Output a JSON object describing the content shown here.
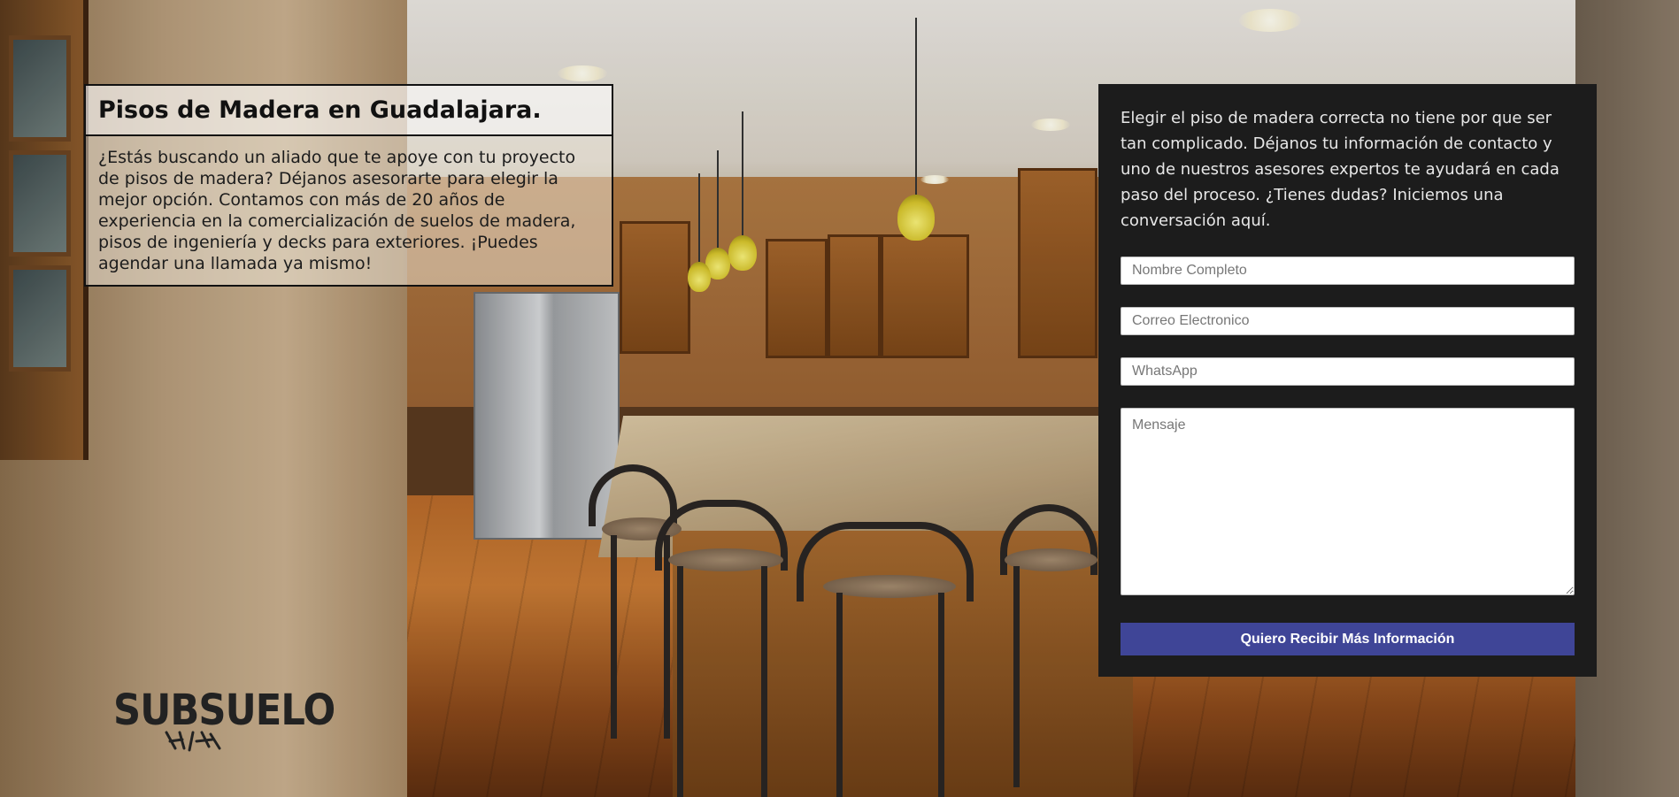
{
  "hero": {
    "title": "Pisos de Madera en Guadalajara.",
    "text": "¿Estás buscando un aliado que te apoye con tu proyecto de pisos de madera? Déjanos asesorarte para elegir la mejor opción. Contamos con más de 20 años de experiencia en la comercialización de suelos de madera, pisos de ingeniería y decks para exteriores. ¡Puedes agendar una llamada ya mismo!"
  },
  "logo": {
    "text": "SUBSUELO"
  },
  "form": {
    "intro": "Elegir el piso de madera correcta no tiene por que ser tan complicado. Déjanos tu información de contacto y uno de nuestros asesores expertos te ayudará en cada paso del proceso. ¿Tienes dudas? Iniciemos una conversación aquí.",
    "name_placeholder": "Nombre Completo",
    "email_placeholder": "Correo Electronico",
    "whatsapp_placeholder": "WhatsApp",
    "message_placeholder": "Mensaje",
    "submit_label": "Quiero Recibir Más Información"
  },
  "colors": {
    "panel_bg": "#1c1c1c",
    "button_bg": "#3f4597"
  }
}
